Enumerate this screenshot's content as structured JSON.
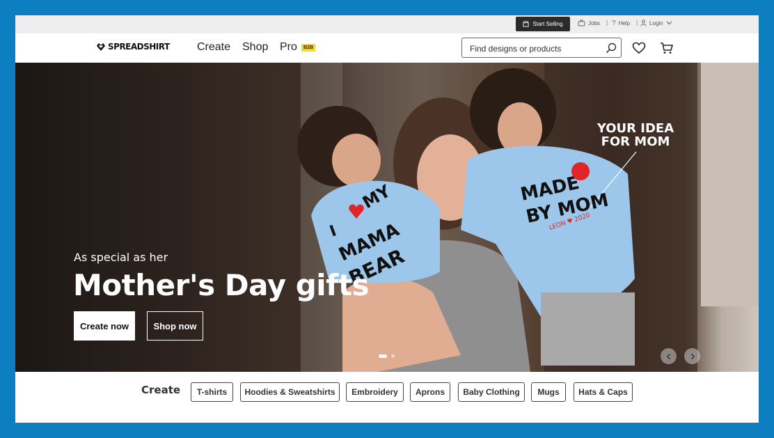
{
  "utility_bar": {
    "start_selling": "Start Selling",
    "jobs": "Jobs",
    "help": "Help",
    "login": "Login"
  },
  "header": {
    "logo": "SPREADSHIRT",
    "nav": [
      "Create",
      "Shop",
      "Pro"
    ],
    "pro_badge": "B2B",
    "search_placeholder": "Find designs or products"
  },
  "hero": {
    "subtitle": "As special as her",
    "title": "Mother's Day gifts",
    "primary_button": "Create now",
    "secondary_button": "Shop now",
    "callout": [
      "YOUR IDEA",
      "FOR MOM"
    ],
    "shirt_left": [
      "I",
      "MY",
      "MAMA",
      "BEAR"
    ],
    "shirt_right": [
      "MADE",
      "BY MOM",
      "LEON ♥ 2020"
    ],
    "slide_count": 2,
    "active_slide": 1
  },
  "categories": {
    "label": "Create",
    "items": [
      "T-shirts",
      "Hoodies & Sweatshirts",
      "Embroidery",
      "Aprons",
      "Baby Clothing",
      "Mugs",
      "Hats & Caps"
    ]
  },
  "colors": {
    "background": "#0d7fc0",
    "badge": "#f7d82a",
    "dark_button": "#2b2b2b",
    "shirt_blue": "#9cc6ea"
  }
}
